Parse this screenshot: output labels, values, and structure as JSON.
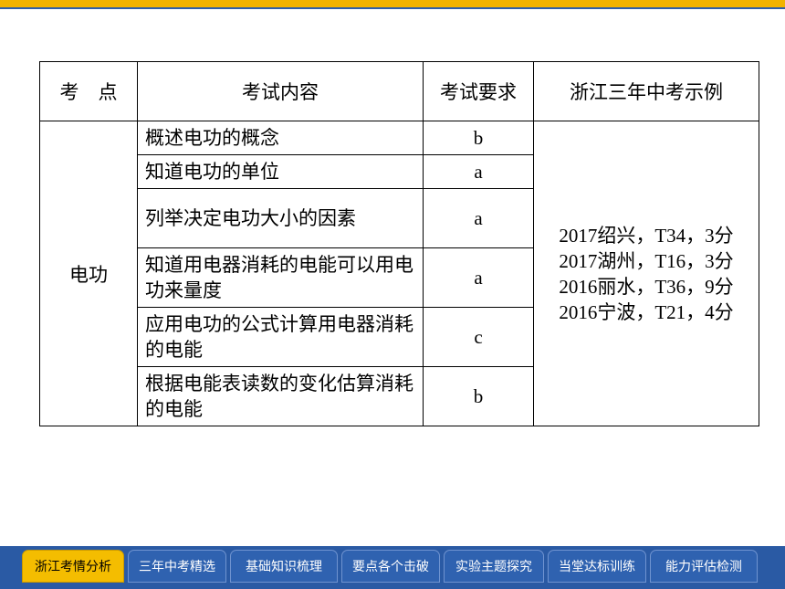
{
  "table": {
    "headers": [
      "考　点",
      "考试内容",
      "考试要求",
      "浙江三年中考示例"
    ],
    "point": "电功",
    "rows": [
      {
        "content": "概述电功的概念",
        "req": "b"
      },
      {
        "content": "知道电功的单位",
        "req": "a"
      },
      {
        "content": "列举决定电功大小的因素",
        "req": "a"
      },
      {
        "content": "知道用电器消耗的电能可以用电功来量度",
        "req": "a"
      },
      {
        "content": "应用电功的公式计算用电器消耗的电能",
        "req": "c"
      },
      {
        "content": "根据电能表读数的变化估算消耗的电能",
        "req": "b"
      }
    ],
    "examples": [
      "2017绍兴，T34，3分",
      "2017湖州，T16，3分",
      "2016丽水，T36，9分",
      "2016宁波，T21，4分"
    ]
  },
  "tabs": [
    {
      "label": "浙江考情分析",
      "active": true
    },
    {
      "label": "三年中考精选",
      "active": false
    },
    {
      "label": "基础知识梳理",
      "active": false
    },
    {
      "label": "要点各个击破",
      "active": false
    },
    {
      "label": "实验主题探究",
      "active": false
    },
    {
      "label": "当堂达标训练",
      "active": false
    },
    {
      "label": "能力评估检测",
      "active": false
    }
  ],
  "colors": {
    "accent": "#f4bd00",
    "nav": "#2a5aa4"
  }
}
